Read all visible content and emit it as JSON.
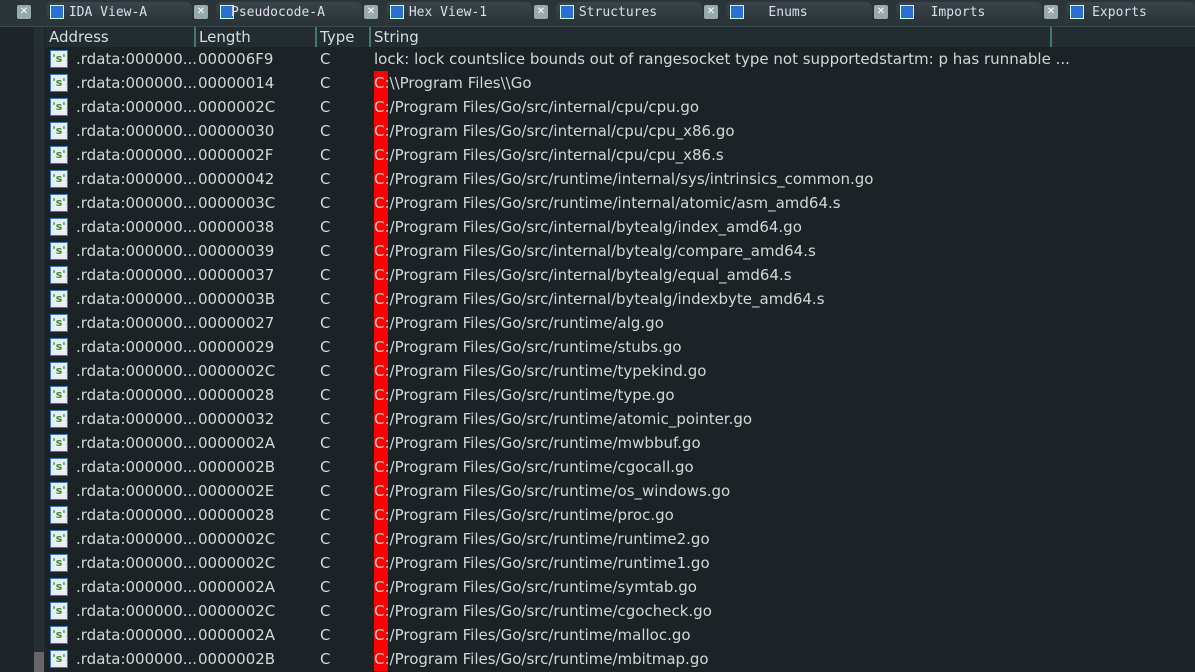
{
  "tabs": [
    {
      "label": "IDA View-A",
      "icon": "ida-view-icon"
    },
    {
      "label": "Pseudocode-A",
      "icon": "pseudocode-icon"
    },
    {
      "label": "Hex View-1",
      "icon": "hex-view-icon"
    },
    {
      "label": "Structures",
      "icon": "structures-icon"
    },
    {
      "label": "Enums",
      "icon": "enums-icon"
    },
    {
      "label": "Imports",
      "icon": "imports-icon"
    },
    {
      "label": "Exports",
      "icon": "exports-icon"
    }
  ],
  "close_glyph": "✕",
  "columns": {
    "address": "Address",
    "length": "Length",
    "type": "Type",
    "string": "String"
  },
  "rows": [
    {
      "address": ".rdata:000000...",
      "length": "000006F9",
      "type": "C",
      "string": "lock: lock countslice bounds out of rangesocket type not supportedstartm: p has runnable ..."
    },
    {
      "address": ".rdata:000000...",
      "length": "00000014",
      "type": "C",
      "string": "C:\\\\Program Files\\\\Go"
    },
    {
      "address": ".rdata:000000...",
      "length": "0000002C",
      "type": "C",
      "string": "C:/Program Files/Go/src/internal/cpu/cpu.go"
    },
    {
      "address": ".rdata:000000...",
      "length": "00000030",
      "type": "C",
      "string": "C:/Program Files/Go/src/internal/cpu/cpu_x86.go"
    },
    {
      "address": ".rdata:000000...",
      "length": "0000002F",
      "type": "C",
      "string": "C:/Program Files/Go/src/internal/cpu/cpu_x86.s"
    },
    {
      "address": ".rdata:000000...",
      "length": "00000042",
      "type": "C",
      "string": "C:/Program Files/Go/src/runtime/internal/sys/intrinsics_common.go"
    },
    {
      "address": ".rdata:000000...",
      "length": "0000003C",
      "type": "C",
      "string": "C:/Program Files/Go/src/runtime/internal/atomic/asm_amd64.s"
    },
    {
      "address": ".rdata:000000...",
      "length": "00000038",
      "type": "C",
      "string": "C:/Program Files/Go/src/internal/bytealg/index_amd64.go"
    },
    {
      "address": ".rdata:000000...",
      "length": "00000039",
      "type": "C",
      "string": "C:/Program Files/Go/src/internal/bytealg/compare_amd64.s"
    },
    {
      "address": ".rdata:000000...",
      "length": "00000037",
      "type": "C",
      "string": "C:/Program Files/Go/src/internal/bytealg/equal_amd64.s"
    },
    {
      "address": ".rdata:000000...",
      "length": "0000003B",
      "type": "C",
      "string": "C:/Program Files/Go/src/internal/bytealg/indexbyte_amd64.s"
    },
    {
      "address": ".rdata:000000...",
      "length": "00000027",
      "type": "C",
      "string": "C:/Program Files/Go/src/runtime/alg.go"
    },
    {
      "address": ".rdata:000000...",
      "length": "00000029",
      "type": "C",
      "string": "C:/Program Files/Go/src/runtime/stubs.go"
    },
    {
      "address": ".rdata:000000...",
      "length": "0000002C",
      "type": "C",
      "string": "C:/Program Files/Go/src/runtime/typekind.go"
    },
    {
      "address": ".rdata:000000...",
      "length": "00000028",
      "type": "C",
      "string": "C:/Program Files/Go/src/runtime/type.go"
    },
    {
      "address": ".rdata:000000...",
      "length": "00000032",
      "type": "C",
      "string": "C:/Program Files/Go/src/runtime/atomic_pointer.go"
    },
    {
      "address": ".rdata:000000...",
      "length": "0000002A",
      "type": "C",
      "string": "C:/Program Files/Go/src/runtime/mwbbuf.go"
    },
    {
      "address": ".rdata:000000...",
      "length": "0000002B",
      "type": "C",
      "string": "C:/Program Files/Go/src/runtime/cgocall.go"
    },
    {
      "address": ".rdata:000000...",
      "length": "0000002E",
      "type": "C",
      "string": "C:/Program Files/Go/src/runtime/os_windows.go"
    },
    {
      "address": ".rdata:000000...",
      "length": "00000028",
      "type": "C",
      "string": "C:/Program Files/Go/src/runtime/proc.go"
    },
    {
      "address": ".rdata:000000...",
      "length": "0000002C",
      "type": "C",
      "string": "C:/Program Files/Go/src/runtime/runtime2.go"
    },
    {
      "address": ".rdata:000000...",
      "length": "0000002C",
      "type": "C",
      "string": "C:/Program Files/Go/src/runtime/runtime1.go"
    },
    {
      "address": ".rdata:000000...",
      "length": "0000002A",
      "type": "C",
      "string": "C:/Program Files/Go/src/runtime/symtab.go"
    },
    {
      "address": ".rdata:000000...",
      "length": "0000002C",
      "type": "C",
      "string": "C:/Program Files/Go/src/runtime/cgocheck.go"
    },
    {
      "address": ".rdata:000000...",
      "length": "0000002A",
      "type": "C",
      "string": "C:/Program Files/Go/src/runtime/malloc.go"
    },
    {
      "address": ".rdata:000000...",
      "length": "0000002B",
      "type": "C",
      "string": "C:/Program Files/Go/src/runtime/mbitmap.go"
    }
  ],
  "string_icon_glyph": "'s'",
  "highlight_color": "#ff0000"
}
